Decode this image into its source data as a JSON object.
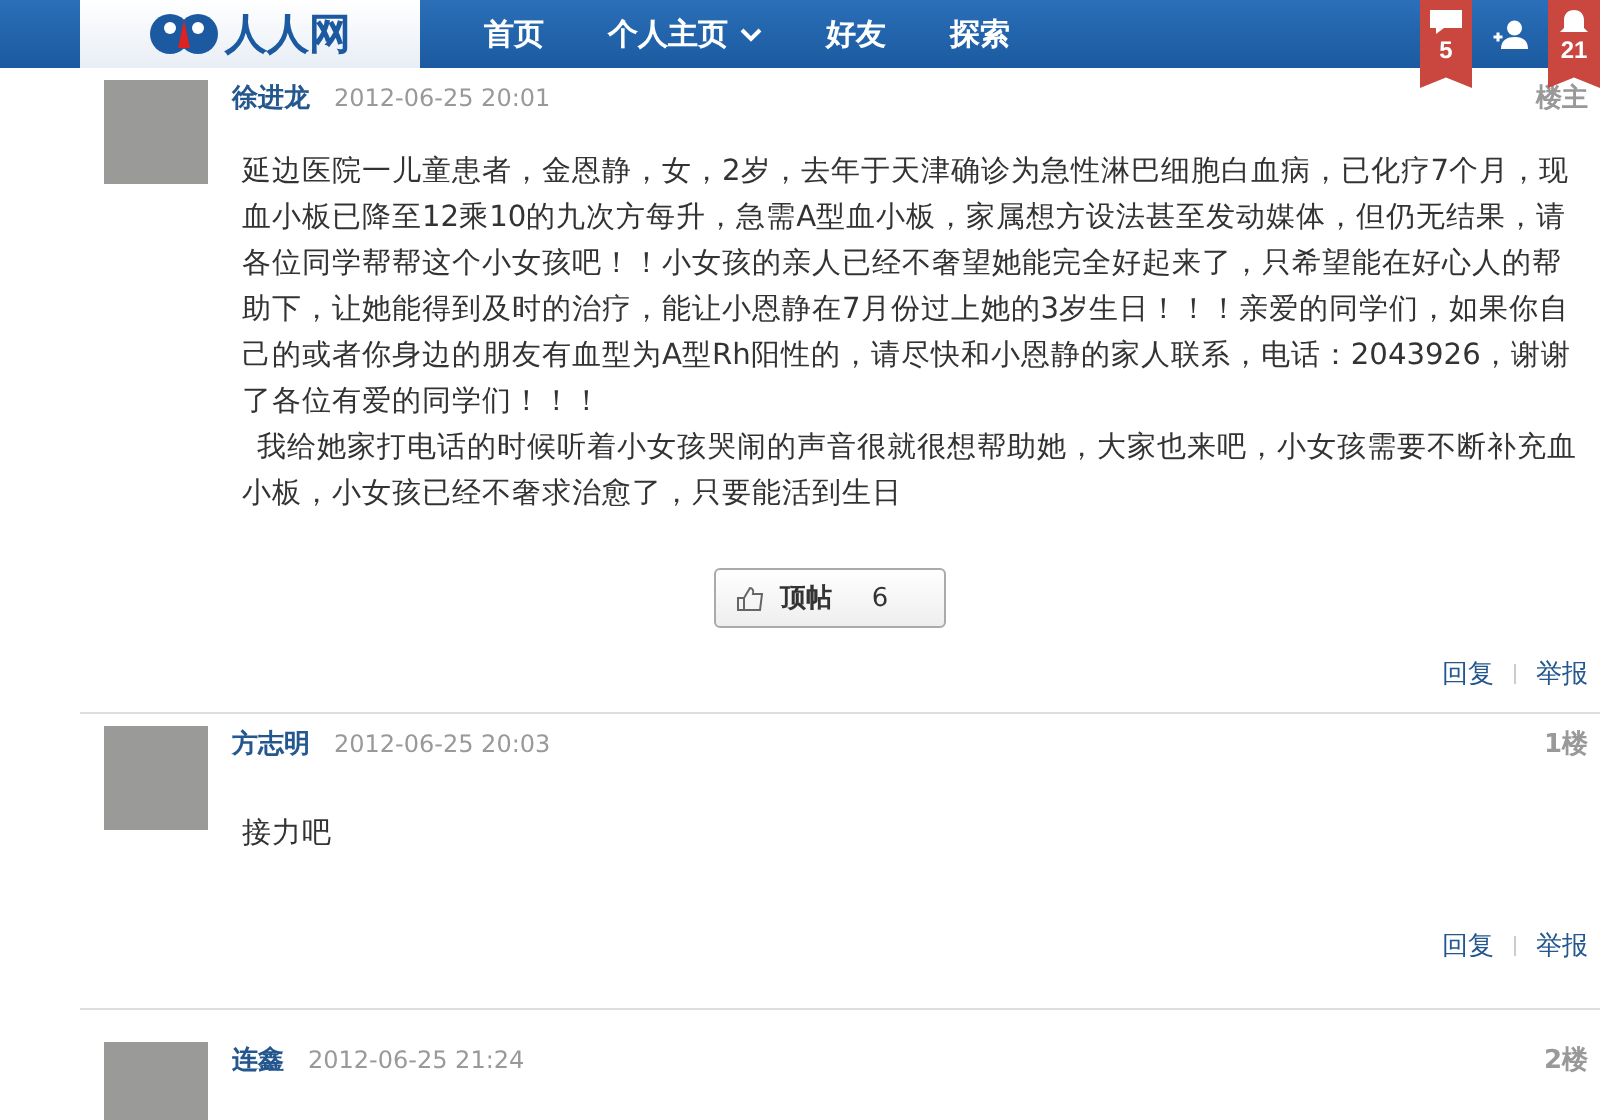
{
  "nav": {
    "logo": "人人网",
    "items": [
      {
        "label": "首页",
        "kind": "link"
      },
      {
        "label": "个人主页",
        "kind": "dropdown"
      },
      {
        "label": "好友",
        "kind": "link"
      },
      {
        "label": "探索",
        "kind": "link"
      }
    ],
    "badges": [
      {
        "kind": "message",
        "count": "5"
      },
      {
        "kind": "add-friend"
      },
      {
        "kind": "bell",
        "count": "21"
      }
    ]
  },
  "posts": [
    {
      "author": "徐进龙",
      "time": "2012-06-25 20:01",
      "floor": "楼主",
      "body": [
        {
          "text": "延边医院一儿童患者，金恩静，女，2岁，去年于天津确诊为急性淋巴细胞白血病，已化疗7个月，现血小板已降至12乘10的九次方每升，急需A型血小板，家属想方设法甚至发动媒体，但仍无结果，请各位同学帮帮这个小女孩吧！！小女孩的亲人已经不奢望她能完全好起来了，只希望能在好心人的帮助下，让她能得到及时的治疗，能让小恩静在7月份过上她的3岁生日！！！亲爱的同学们，如果你自己的或者你身边的朋友有血型为A型Rh阳性的，请尽快和小恩静的家人联系，电话：2043926，谢谢了各位有爱的同学们！！！",
          "indented": false
        },
        {
          "text": "我给她家打电话的时候听着小女孩哭闹的声音很就很想帮助她，大家也来吧，小女孩需要不断补充血小板，小女孩已经不奢求治愈了，只要能活到生日",
          "indented": true
        }
      ],
      "like": {
        "label": "顶帖",
        "count": "6"
      },
      "actions": [
        "回复",
        "举报"
      ]
    },
    {
      "author": "方志明",
      "time": "2012-06-25 20:03",
      "floor": "1楼",
      "body": [
        {
          "text": "接力吧",
          "indented": false
        }
      ],
      "actions": [
        "回复",
        "举报"
      ]
    },
    {
      "author": "连鑫",
      "time": "2012-06-25 21:24",
      "floor": "2楼"
    }
  ]
}
